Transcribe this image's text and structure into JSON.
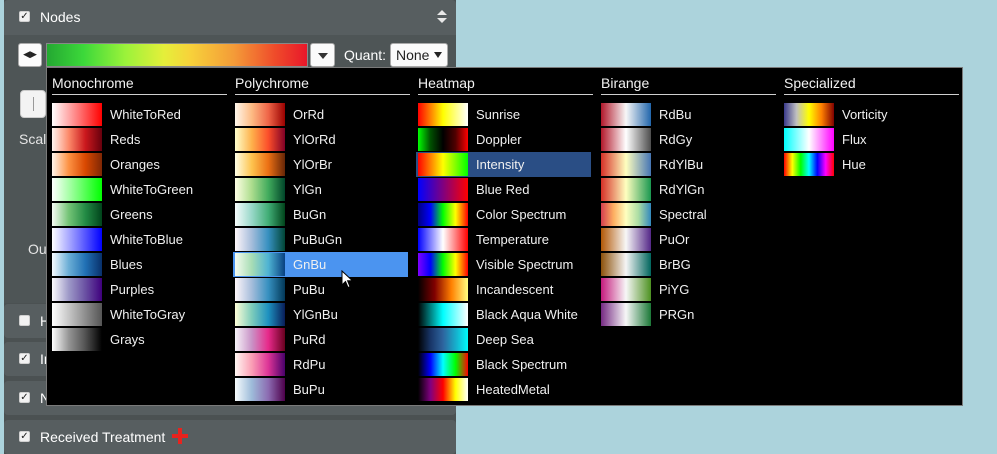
{
  "panel": {
    "nodes_title": "Nodes",
    "quant_label": "Quant:",
    "quant_value": "None",
    "scale_label_fragment": "Scal",
    "outline_label_fragment": "Ou",
    "sections": [
      {
        "key": "h",
        "label": "H",
        "checked": false
      },
      {
        "key": "in",
        "label": "In",
        "checked": true
      },
      {
        "key": "n",
        "label": "N",
        "checked": true
      },
      {
        "key": "received",
        "label": "Received Treatment",
        "checked": true
      }
    ]
  },
  "dropdown": {
    "columns": [
      {
        "title": "Monochrome",
        "items": [
          {
            "label": "WhiteToRed",
            "colors": [
              "#ffffff",
              "#ff0000"
            ]
          },
          {
            "label": "Reds",
            "colors": [
              "#fff5f0",
              "#fc8a6a",
              "#cb181d",
              "#67000d"
            ]
          },
          {
            "label": "Oranges",
            "colors": [
              "#fff5eb",
              "#fd9243",
              "#d94801",
              "#7f2704"
            ]
          },
          {
            "label": "WhiteToGreen",
            "colors": [
              "#ffffff",
              "#00ff00"
            ]
          },
          {
            "label": "Greens",
            "colors": [
              "#f7fcf5",
              "#74c476",
              "#238b45",
              "#00441b"
            ]
          },
          {
            "label": "WhiteToBlue",
            "colors": [
              "#ffffff",
              "#0000ff"
            ]
          },
          {
            "label": "Blues",
            "colors": [
              "#f7fbff",
              "#6baed6",
              "#2171b5",
              "#08306b"
            ]
          },
          {
            "label": "Purples",
            "colors": [
              "#fcfbfd",
              "#9e9ac8",
              "#6a51a3",
              "#3f007d"
            ]
          },
          {
            "label": "WhiteToGray",
            "colors": [
              "#ffffff",
              "#555555"
            ]
          },
          {
            "label": "Grays",
            "colors": [
              "#ffffff",
              "#969696",
              "#525252",
              "#000000"
            ]
          }
        ]
      },
      {
        "title": "Polychrome",
        "items": [
          {
            "label": "OrRd",
            "colors": [
              "#fff7ec",
              "#fdbb84",
              "#ef6548",
              "#990000"
            ]
          },
          {
            "label": "YlOrRd",
            "colors": [
              "#ffffcc",
              "#feb24c",
              "#fc4e2a",
              "#800026"
            ]
          },
          {
            "label": "YlOrBr",
            "colors": [
              "#ffffe5",
              "#fec44f",
              "#ec7014",
              "#662506"
            ]
          },
          {
            "label": "YlGn",
            "colors": [
              "#ffffe5",
              "#addd8e",
              "#41ab5d",
              "#004529"
            ]
          },
          {
            "label": "BuGn",
            "colors": [
              "#f7fcfd",
              "#99d8c9",
              "#41ae76",
              "#00441b"
            ]
          },
          {
            "label": "PuBuGn",
            "colors": [
              "#fff7fb",
              "#a6bddb",
              "#3690c0",
              "#014636"
            ]
          },
          {
            "label": "GnBu",
            "colors": [
              "#f7fcf0",
              "#a8ddb5",
              "#4eb3d3",
              "#084081"
            ]
          },
          {
            "label": "PuBu",
            "colors": [
              "#fff7fb",
              "#a6bddb",
              "#3690c0",
              "#023858"
            ]
          },
          {
            "label": "YlGnBu",
            "colors": [
              "#ffffd9",
              "#7fcdbb",
              "#1d91c0",
              "#081d58"
            ]
          },
          {
            "label": "PuRd",
            "colors": [
              "#f7f4f9",
              "#c994c7",
              "#e7298a",
              "#67001f"
            ]
          },
          {
            "label": "RdPu",
            "colors": [
              "#fff7f3",
              "#fa9fb5",
              "#dd3497",
              "#49006a"
            ]
          },
          {
            "label": "BuPu",
            "colors": [
              "#f7fcfd",
              "#9ebcda",
              "#8c6bb1",
              "#4d004b"
            ]
          }
        ]
      },
      {
        "title": "Heatmap",
        "items": [
          {
            "label": "Sunrise",
            "colors": [
              "#ff0000",
              "#ffff00",
              "#ffffff"
            ]
          },
          {
            "label": "Doppler",
            "colors": [
              "#00ff00",
              "#005000",
              "#000000",
              "#500000",
              "#ff0000"
            ]
          },
          {
            "label": "Intensity",
            "colors": [
              "#ff0000",
              "#ffff00",
              "#00ff00"
            ]
          },
          {
            "label": "Blue Red",
            "colors": [
              "#0000ff",
              "#ff0000"
            ]
          },
          {
            "label": "Color Spectrum",
            "colors": [
              "#000080",
              "#0000ff",
              "#00ff00",
              "#ffff00",
              "#ff0000"
            ]
          },
          {
            "label": "Temperature",
            "colors": [
              "#0000ff",
              "#ffffff",
              "#ff0000"
            ]
          },
          {
            "label": "Visible Spectrum",
            "colors": [
              "#8000ff",
              "#0000ff",
              "#00ff00",
              "#ffff00",
              "#ff0000"
            ]
          },
          {
            "label": "Incandescent",
            "colors": [
              "#000000",
              "#800000",
              "#ff8000",
              "#ffff80"
            ]
          },
          {
            "label": "Black Aqua White",
            "colors": [
              "#000000",
              "#00ffff",
              "#ffffff"
            ]
          },
          {
            "label": "Deep Sea",
            "colors": [
              "#000000",
              "#183567",
              "#2e649e",
              "#17adcb",
              "#00fafa"
            ]
          },
          {
            "label": "Black Spectrum",
            "colors": [
              "#000000",
              "#0000ff",
              "#00ffff",
              "#00ff00",
              "#ff0000"
            ]
          },
          {
            "label": "HeatedMetal",
            "colors": [
              "#000000",
              "#800080",
              "#ff0000",
              "#ffff00",
              "#ffffff"
            ]
          }
        ]
      },
      {
        "title": "Birange",
        "items": [
          {
            "label": "RdBu",
            "colors": [
              "#b2182b",
              "#f7f7f7",
              "#2166ac"
            ]
          },
          {
            "label": "RdGy",
            "colors": [
              "#b2182b",
              "#ffffff",
              "#4d4d4d"
            ]
          },
          {
            "label": "RdYlBu",
            "colors": [
              "#d73027",
              "#ffffbf",
              "#4575b4"
            ]
          },
          {
            "label": "RdYlGn",
            "colors": [
              "#d73027",
              "#ffffbf",
              "#1a9850"
            ]
          },
          {
            "label": "Spectral",
            "colors": [
              "#d53e4f",
              "#fdae61",
              "#ffffbf",
              "#abdda4",
              "#3288bd"
            ]
          },
          {
            "label": "PuOr",
            "colors": [
              "#b35806",
              "#f7f7f7",
              "#542788"
            ]
          },
          {
            "label": "BrBG",
            "colors": [
              "#8c510a",
              "#f5f5f5",
              "#01665e"
            ]
          },
          {
            "label": "PiYG",
            "colors": [
              "#c51b7d",
              "#f7f7f7",
              "#4d9221"
            ]
          },
          {
            "label": "PRGn",
            "colors": [
              "#762a83",
              "#f7f7f7",
              "#1b7837"
            ]
          }
        ]
      },
      {
        "title": "Specialized",
        "items": [
          {
            "label": "Vorticity",
            "colors": [
              "#3a3a8c",
              "#c0c0c0",
              "#ffff00",
              "#ff8000",
              "#800000"
            ]
          },
          {
            "label": "Flux",
            "colors": [
              "#00ffff",
              "#ffffff",
              "#ff00ff"
            ]
          },
          {
            "label": "Hue",
            "colors": [
              "#ff0000",
              "#ffff00",
              "#00ff00",
              "#00ffff",
              "#0000ff",
              "#ff00ff",
              "#ff0000"
            ]
          }
        ]
      }
    ]
  }
}
